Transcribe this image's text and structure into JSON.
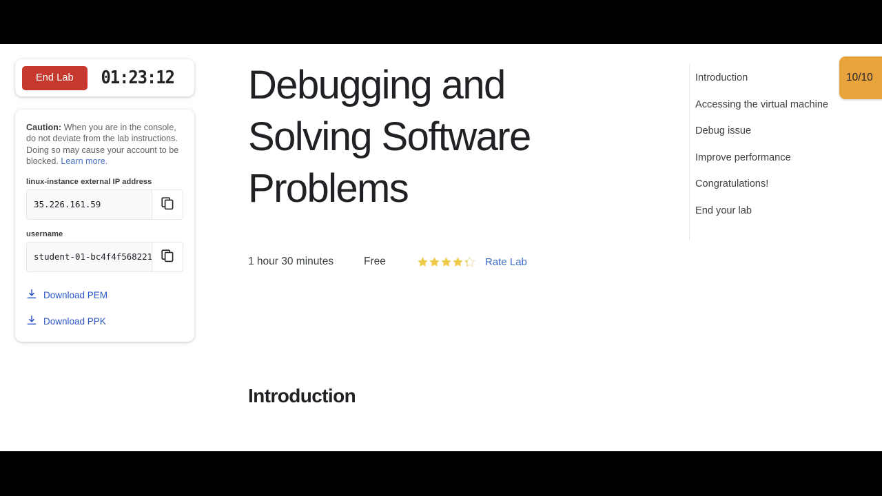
{
  "lab_panel": {
    "end_lab_label": "End Lab",
    "timer": "01:23:12",
    "caution_label": "Caution:",
    "caution_text": " When you are in the console, do not deviate from the lab instructions. Doing so may cause your account to be blocked. ",
    "learn_more_label": "Learn more.",
    "fields": [
      {
        "label": "linux-instance external IP address",
        "value": "35.226.161.59",
        "copy_icon": "copy-icon"
      },
      {
        "label": "username",
        "value": "student-01-bc4f4f568221",
        "copy_icon": "copy-icon"
      }
    ],
    "downloads": [
      {
        "label": "Download PEM",
        "icon": "download-icon"
      },
      {
        "label": "Download PPK",
        "icon": "download-icon"
      }
    ]
  },
  "main": {
    "title": "Debugging and Solving Software Problems",
    "duration": "1 hour 30 minutes",
    "price": "Free",
    "rating_stars": 4.25,
    "rate_lab_label": "Rate Lab",
    "section_heading": "Introduction"
  },
  "sidebar": {
    "items": [
      {
        "label": "Introduction"
      },
      {
        "label": "Accessing the virtual machine"
      },
      {
        "label": "Debug issue"
      },
      {
        "label": "Improve performance"
      },
      {
        "label": "Congratulations!"
      },
      {
        "label": "End your lab"
      }
    ]
  },
  "progress": {
    "score": "10/10"
  },
  "colors": {
    "end_lab_red": "#c5392e",
    "link_blue": "#2a56c6",
    "badge_orange": "#e8a33d",
    "star_gold": "#f0cb4a",
    "text_primary": "#202124",
    "text_secondary": "#5f6368"
  }
}
